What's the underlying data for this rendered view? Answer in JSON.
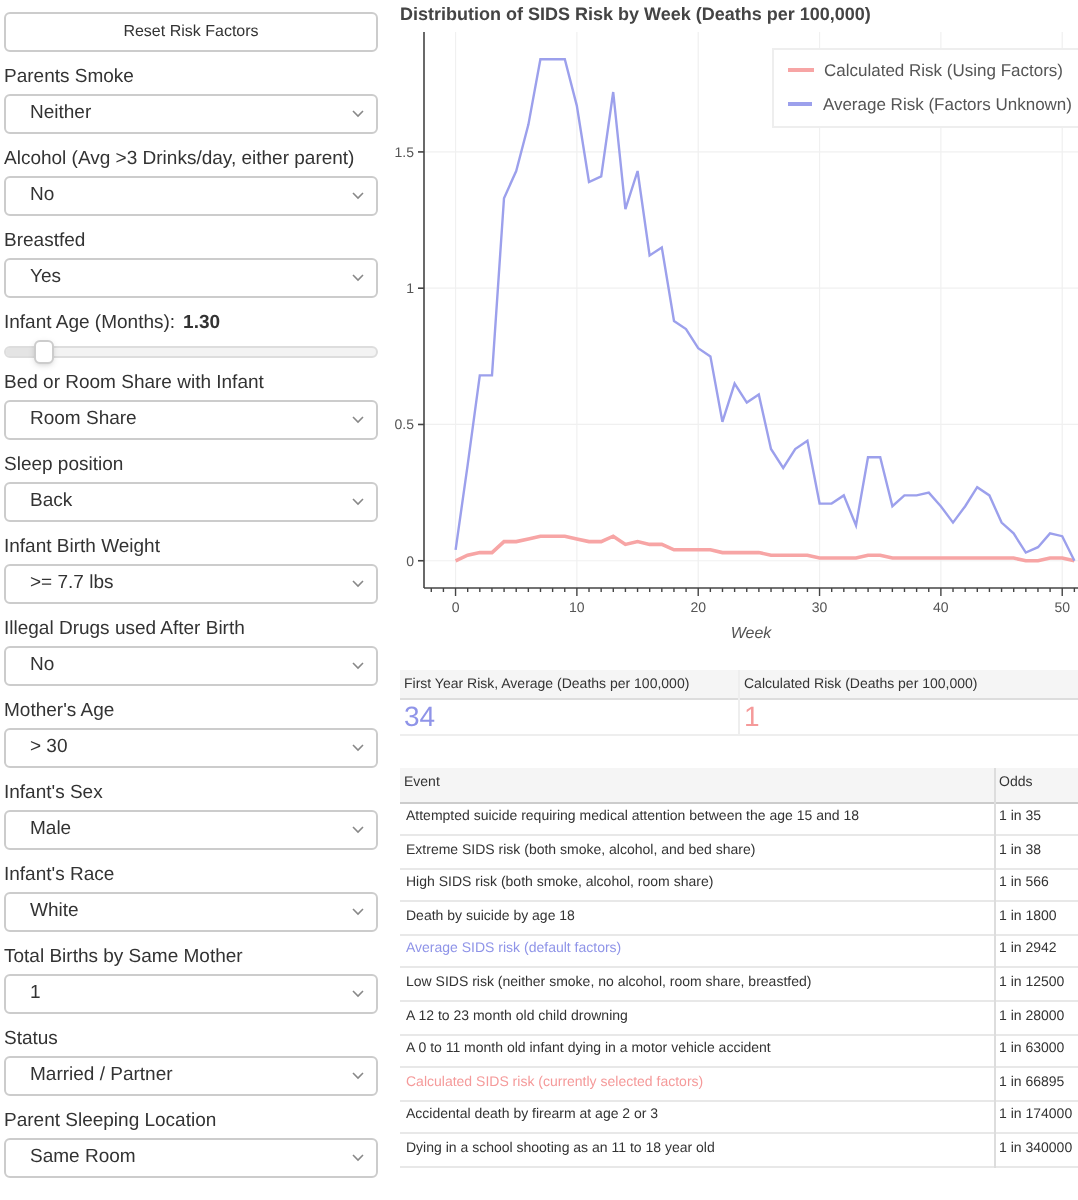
{
  "reset_button": "Reset Risk Factors",
  "controls": [
    {
      "kind": "select",
      "label": "Parents Smoke",
      "value": "Neither"
    },
    {
      "kind": "select",
      "label": "Alcohol (Avg >3 Drinks/day, either parent)",
      "value": "No"
    },
    {
      "kind": "select",
      "label": "Breastfed",
      "value": "Yes"
    },
    {
      "kind": "slider",
      "label": "Infant Age (Months):",
      "value": "1.30",
      "level": 0.1
    },
    {
      "kind": "select",
      "label": "Bed or Room Share with Infant",
      "value": "Room Share"
    },
    {
      "kind": "select",
      "label": "Sleep position",
      "value": "Back"
    },
    {
      "kind": "select",
      "label": "Infant Birth Weight",
      "value": ">= 7.7 lbs"
    },
    {
      "kind": "select",
      "label": "Illegal Drugs used After Birth",
      "value": "No"
    },
    {
      "kind": "select",
      "label": "Mother's Age",
      "value": "> 30"
    },
    {
      "kind": "select",
      "label": "Infant's Sex",
      "value": "Male"
    },
    {
      "kind": "select",
      "label": "Infant's Race",
      "value": "White"
    },
    {
      "kind": "select",
      "label": "Total Births by Same Mother",
      "value": "1"
    },
    {
      "kind": "select",
      "label": "Status",
      "value": "Married / Partner"
    },
    {
      "kind": "select",
      "label": "Parent Sleeping Location",
      "value": "Same Room"
    }
  ],
  "chart": {
    "chart_data": {
      "type": "line",
      "title": "Distribution of SIDS Risk by Week (Deaths per 100,000)",
      "xlabel": "Week",
      "x": [
        0,
        1,
        2,
        3,
        4,
        5,
        6,
        7,
        8,
        9,
        10,
        11,
        12,
        13,
        14,
        15,
        16,
        17,
        18,
        19,
        20,
        21,
        22,
        23,
        24,
        25,
        26,
        27,
        28,
        29,
        30,
        31,
        32,
        33,
        34,
        35,
        36,
        37,
        38,
        39,
        40,
        41,
        42,
        43,
        44,
        45,
        46,
        47,
        48,
        49,
        50,
        51
      ],
      "series": [
        {
          "name": "Calculated Risk (Using Factors)",
          "color": "#f7a5a5",
          "values": [
            0,
            0.02,
            0.03,
            0.03,
            0.07,
            0.07,
            0.08,
            0.09,
            0.09,
            0.09,
            0.08,
            0.07,
            0.07,
            0.09,
            0.06,
            0.07,
            0.06,
            0.06,
            0.04,
            0.04,
            0.04,
            0.04,
            0.03,
            0.03,
            0.03,
            0.03,
            0.02,
            0.02,
            0.02,
            0.02,
            0.01,
            0.01,
            0.01,
            0.01,
            0.02,
            0.02,
            0.01,
            0.01,
            0.01,
            0.01,
            0.01,
            0.01,
            0.01,
            0.01,
            0.01,
            0.01,
            0.01,
            0,
            0,
            0.01,
            0.01,
            0
          ]
        },
        {
          "name": "Average Risk (Factors Unknown)",
          "color": "#9ca0ec",
          "values": [
            0.04,
            0.35,
            0.68,
            0.68,
            1.33,
            1.43,
            1.6,
            1.84,
            1.84,
            1.84,
            1.67,
            1.39,
            1.41,
            1.72,
            1.29,
            1.43,
            1.12,
            1.15,
            0.88,
            0.85,
            0.78,
            0.75,
            0.51,
            0.65,
            0.58,
            0.61,
            0.41,
            0.34,
            0.41,
            0.44,
            0.21,
            0.21,
            0.24,
            0.13,
            0.38,
            0.38,
            0.2,
            0.24,
            0.24,
            0.25,
            0.2,
            0.14,
            0.2,
            0.27,
            0.24,
            0.14,
            0.1,
            0.03,
            0.05,
            0.1,
            0.09,
            0
          ]
        }
      ],
      "xlim": [
        -2.6,
        51.3
      ],
      "ylim": [
        -0.1,
        1.94
      ],
      "grid": true,
      "legend": true,
      "xticks": [
        0,
        10,
        20,
        30,
        40,
        50
      ],
      "yticks": [
        0,
        0.5,
        1,
        1.5
      ]
    }
  },
  "summary": [
    {
      "label": "First Year Risk, Average (Deaths per 100,000)",
      "value": "34",
      "color": "#8f94e8"
    },
    {
      "label": "Calculated Risk (Deaths per 100,000)",
      "value": "1",
      "color": "#f59a9a"
    }
  ],
  "events_table": {
    "columns": [
      "Event",
      "Odds"
    ],
    "rows": [
      {
        "event": "Attempted suicide requiring medical attention between the age 15 and 18",
        "odds": "1 in 35"
      },
      {
        "event": "Extreme SIDS risk (both smoke, alcohol, and bed share)",
        "odds": "1 in 38"
      },
      {
        "event": "High SIDS risk (both smoke, alcohol, room share)",
        "odds": "1 in 566"
      },
      {
        "event": "Death by suicide by age 18",
        "odds": "1 in 1800"
      },
      {
        "event": "Average SIDS risk (default factors)",
        "odds": "1 in 2942",
        "color": "#8f94e8"
      },
      {
        "event": "Low SIDS risk (neither smoke, no alcohol, room share, breastfed)",
        "odds": "1 in 12500"
      },
      {
        "event": "A 12 to 23 month old child drowning",
        "odds": "1 in 28000"
      },
      {
        "event": "A 0 to 11 month old infant dying in a motor vehicle accident",
        "odds": "1 in 63000"
      },
      {
        "event": "Calculated SIDS risk (currently selected factors)",
        "odds": "1 in 66895",
        "color": "#f59a9a"
      },
      {
        "event": "Accidental death by firearm at age 2 or 3",
        "odds": "1 in 174000"
      },
      {
        "event": "Dying in a school shooting as an 11 to 18 year old",
        "odds": "1 in 340000"
      }
    ]
  }
}
